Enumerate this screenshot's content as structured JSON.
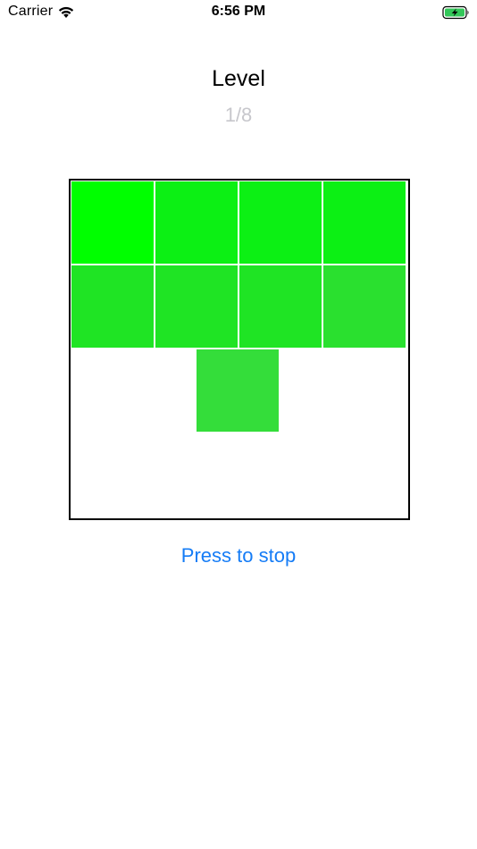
{
  "status_bar": {
    "carrier": "Carrier",
    "time": "6:56 PM",
    "wifi_icon": "wifi-icon",
    "battery_icon": "battery-charging-icon"
  },
  "header": {
    "title": "Level",
    "progress": "1/8"
  },
  "board": {
    "rows": [
      [
        "#00ff00",
        "#0cf014",
        "#0cf014",
        "#0cf014"
      ],
      [
        "#1fe424",
        "#1fe424",
        "#1fe424",
        "#2ae02f"
      ],
      [
        null,
        "#34dd3a",
        null,
        null
      ]
    ],
    "falling_tile_color": "#34dd3a"
  },
  "actions": {
    "stop_label": "Press to stop"
  },
  "colors": {
    "accent": "#157cf6",
    "muted_text": "#c7c7cc",
    "battery_green": "#33c759"
  }
}
